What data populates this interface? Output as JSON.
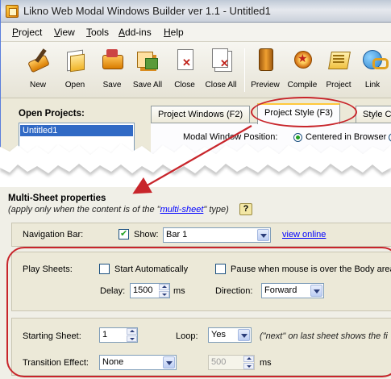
{
  "window": {
    "title": "Likno Web Modal Windows Builder ver 1.1 - Untitled1"
  },
  "menu": [
    "Project",
    "View",
    "Tools",
    "Add-ins",
    "Help"
  ],
  "toolbar": [
    {
      "label": "New",
      "icon": "new-icon"
    },
    {
      "label": "Open",
      "icon": "open-icon"
    },
    {
      "label": "Save",
      "icon": "save-icon"
    },
    {
      "label": "Save All",
      "icon": "save-all-icon"
    },
    {
      "label": "Close",
      "icon": "close-icon"
    },
    {
      "label": "Close All",
      "icon": "close-all-icon"
    },
    {
      "label": "Preview",
      "icon": "preview-icon"
    },
    {
      "label": "Compile",
      "icon": "compile-icon"
    },
    {
      "label": "Project",
      "icon": "project-icon"
    },
    {
      "label": "Link",
      "icon": "link-icon"
    }
  ],
  "projects": {
    "header": "Open Projects:",
    "items": [
      "Untitled1"
    ]
  },
  "tabs": [
    {
      "label": "Project Windows   (F2)"
    },
    {
      "label": "Project Style   (F3)",
      "active": true
    },
    {
      "label": "Style C"
    }
  ],
  "project_style": {
    "modal_position_label": "Modal Window Position:",
    "centered_option": "Centered in Browser"
  },
  "multisheet": {
    "title": "Multi-Sheet properties",
    "subtitle_before": "(apply only when the content is of the \"",
    "subtitle_link": "multi-sheet",
    "subtitle_after": "\" type)",
    "help": "?",
    "nav_bar_label": "Navigation Bar:",
    "show_label": "Show:",
    "show_checked": true,
    "nav_bar_value": "Bar 1",
    "view_online": "view online",
    "play_sheets_label": "Play Sheets:",
    "start_auto_label": "Start Automatically",
    "start_auto_checked": false,
    "pause_label": "Pause when mouse is over the Body area",
    "pause_checked": false,
    "delay_label": "Delay:",
    "delay_value": "1500",
    "delay_unit": "ms",
    "direction_label": "Direction:",
    "direction_value": "Forward",
    "starting_sheet_label": "Starting Sheet:",
    "starting_sheet_value": "1",
    "loop_label": "Loop:",
    "loop_value": "Yes",
    "loop_note": "(\"next\" on last sheet shows the fi",
    "transition_label": "Transition Effect:",
    "transition_value": "None",
    "transition_ms_value": "500",
    "transition_ms_unit": "ms"
  },
  "colors": {
    "highlight": "#c8252b",
    "selection": "#316ac5",
    "link": "#0000ff"
  }
}
